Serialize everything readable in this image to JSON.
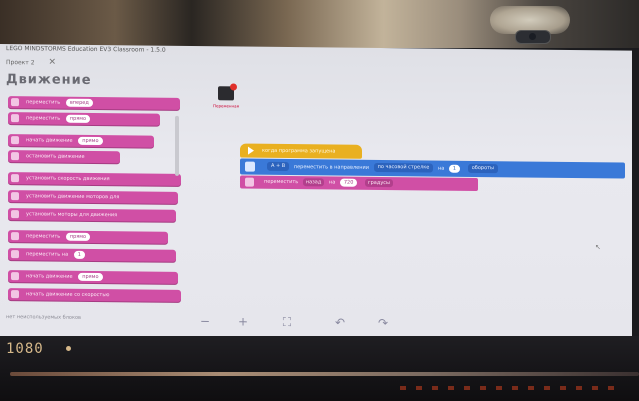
{
  "window": {
    "title": "LEGO MINDSTORMS Education EV3 Classroom - 1.5.0",
    "project_tab": "Проект 2"
  },
  "palette": {
    "category": "Движение",
    "blocks": [
      {
        "text": "переместить",
        "value": "вперед"
      },
      {
        "text": "переместить",
        "value": "прямо"
      },
      {
        "text": "начать движение",
        "value": "прямо"
      },
      {
        "text": "остановить движение",
        "value": ""
      },
      {
        "text": "установить скорость движения",
        "value": ""
      },
      {
        "text": "установить движение моторов для",
        "value": ""
      },
      {
        "text": "установить моторы для движения",
        "value": ""
      },
      {
        "text": "переместить",
        "value": "прямо"
      },
      {
        "text": "переместить на",
        "value": "1"
      },
      {
        "text": "начать движение",
        "value": "прямо"
      },
      {
        "text": "начать движение со скоростью",
        "value": ""
      }
    ]
  },
  "new_variable": "Переменная",
  "script": {
    "hat": "когда программа запущена",
    "move": {
      "ports": "A + B",
      "text": "переместить в направлении",
      "direction": "по часовой стрелке",
      "on": "на",
      "amount": "1",
      "unit": "обороты"
    },
    "stop": {
      "text": "переместить",
      "direction": "назад",
      "on": "на",
      "amount": "720",
      "unit": "градусы"
    }
  },
  "toolbar": {
    "recycle": "нет неиспользуемых блоков",
    "zoom_out": "−",
    "zoom_in": "+",
    "fit": "⛶",
    "undo": "↶",
    "redo": "↷"
  },
  "monitor": {
    "resolution": "1080"
  },
  "colors": {
    "motion_pink": "#d04fa5",
    "motion_blue": "#3a79d8",
    "event_yellow": "#e9b020"
  }
}
